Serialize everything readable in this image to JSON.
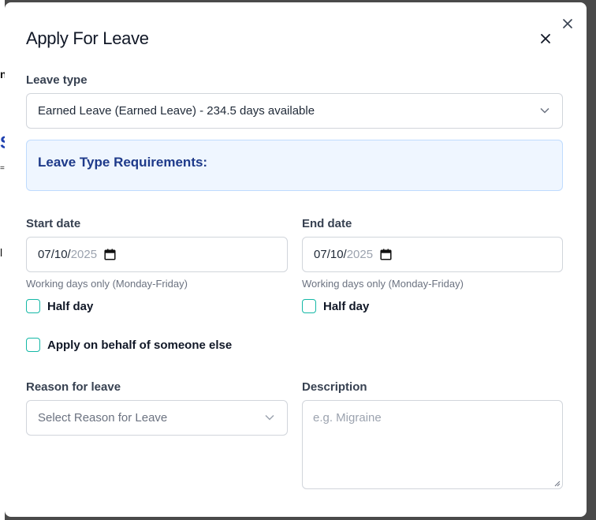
{
  "modal": {
    "title": "Apply For Leave"
  },
  "leave_type": {
    "label": "Leave type",
    "selected": "Earned Leave (Earned Leave) - 234.5 days available"
  },
  "requirements": {
    "title": "Leave Type Requirements:"
  },
  "start_date": {
    "label": "Start date",
    "month": "07",
    "day": "10",
    "year": "2025",
    "hint": "Working days only (Monday-Friday)",
    "half_day_label": "Half day"
  },
  "end_date": {
    "label": "End date",
    "month": "07",
    "day": "10",
    "year": "2025",
    "hint": "Working days only (Monday-Friday)",
    "half_day_label": "Half day"
  },
  "behalf": {
    "label": "Apply on behalf of someone else"
  },
  "reason": {
    "label": "Reason for leave",
    "placeholder": "Select Reason for Leave"
  },
  "description": {
    "label": "Description",
    "placeholder": "e.g. Migraine"
  },
  "icons": {
    "close": "close-icon",
    "chevron": "chevron-down-icon",
    "calendar": "calendar-icon"
  },
  "colors": {
    "accent": "#14b8a6",
    "info_bg": "#eff6ff",
    "info_text": "#1e3a8a"
  }
}
